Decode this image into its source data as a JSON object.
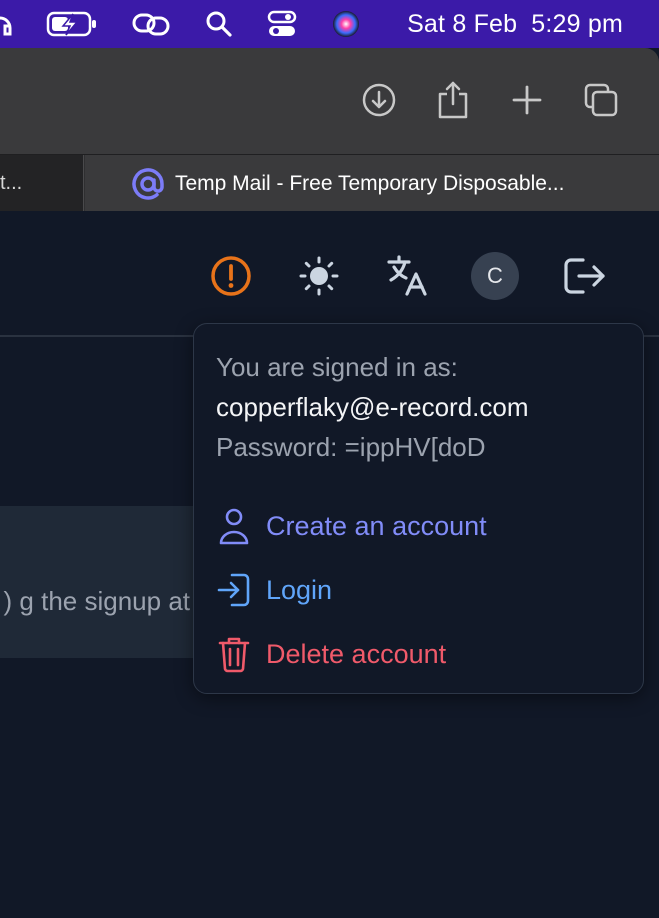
{
  "menubar": {
    "date": "Sat 8 Feb",
    "time": "5:29 pm",
    "icons": [
      "headphones-icon",
      "battery-charging-icon",
      "link-icon",
      "search-icon",
      "control-center-icon",
      "siri-icon"
    ]
  },
  "browser": {
    "toolbar_icons": [
      "download-icon",
      "share-icon",
      "new-tab-icon",
      "tab-overview-icon"
    ],
    "tabs": [
      {
        "title": "t...",
        "active": false
      },
      {
        "title": "Temp Mail - Free Temporary Disposable...",
        "active": true
      }
    ]
  },
  "header": {
    "icons": [
      "alert-icon",
      "sun-icon",
      "translate-icon",
      "avatar",
      "logout-icon"
    ],
    "avatar_letter": "C",
    "alert_color": "#e8731a"
  },
  "background_card": {
    "snippet": "g the signup at (",
    "bg_color": "#1f2937"
  },
  "account_menu": {
    "signed_in_label": "You are signed in as:",
    "email": "copperflaky@e-record.com",
    "password_label": "Password:",
    "password_value": "=ippHV[doD",
    "items": [
      {
        "label": "Create an account",
        "icon": "user-icon",
        "color": "#818cf8"
      },
      {
        "label": "Login",
        "icon": "login-icon",
        "color": "#60a5fa"
      },
      {
        "label": "Delete account",
        "icon": "trash-icon",
        "color": "#f05a6a"
      }
    ]
  }
}
